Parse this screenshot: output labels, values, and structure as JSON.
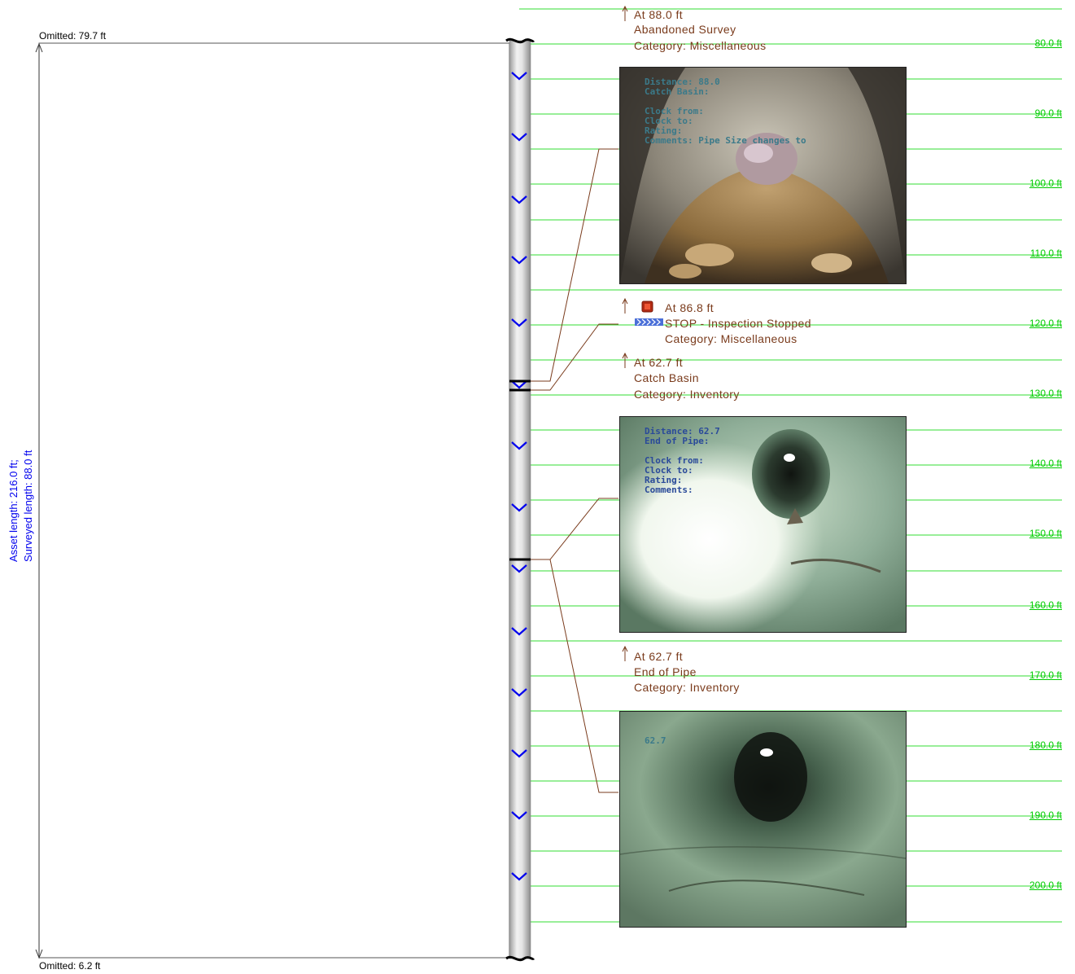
{
  "omitted_top": "Omitted: 79.7 ft",
  "omitted_bottom": "Omitted: 6.2 ft",
  "side_label": {
    "line1": "Asset length: 216.0 ft;",
    "line2": "Surveyed length: 88.0 ft"
  },
  "distance_labels": [
    "80.0 ft",
    "90.0 ft",
    "100.0 ft",
    "110.0 ft",
    "120.0 ft",
    "130.0 ft",
    "140.0 ft",
    "150.0 ft",
    "160.0 ft",
    "170.0 ft",
    "180.0 ft",
    "190.0 ft",
    "200.0 ft"
  ],
  "observations": [
    {
      "at": "At 88.0 ft",
      "title": "Abandoned Survey",
      "category": "Category: Miscellaneous"
    },
    {
      "at": "At 86.8 ft",
      "title": "STOP - Inspection Stopped",
      "category": "Category: Miscellaneous"
    },
    {
      "at": "At 62.7 ft",
      "title": "Catch Basin",
      "category": "Category: Inventory"
    },
    {
      "at": "At 62.7 ft",
      "title": "End of Pipe",
      "category": "Category: Inventory"
    }
  ],
  "photos": [
    {
      "osd": "Distance: 88.0\nCatch Basin:\n\nClock from:\nClock to:\nRating:\nComments: Pipe Size changes to"
    },
    {
      "osd": "Distance: 62.7\nEnd of Pipe:\n\nClock from:\nClock to:\nRating:\nComments:"
    },
    {
      "osd": "62.7"
    }
  ],
  "colors": {
    "grid_line": "#33dd33",
    "distance_label": "#00cc00",
    "observation_text": "#7a3b1c",
    "flow_arrow": "#0000ee",
    "side_label": "#0000ee"
  }
}
